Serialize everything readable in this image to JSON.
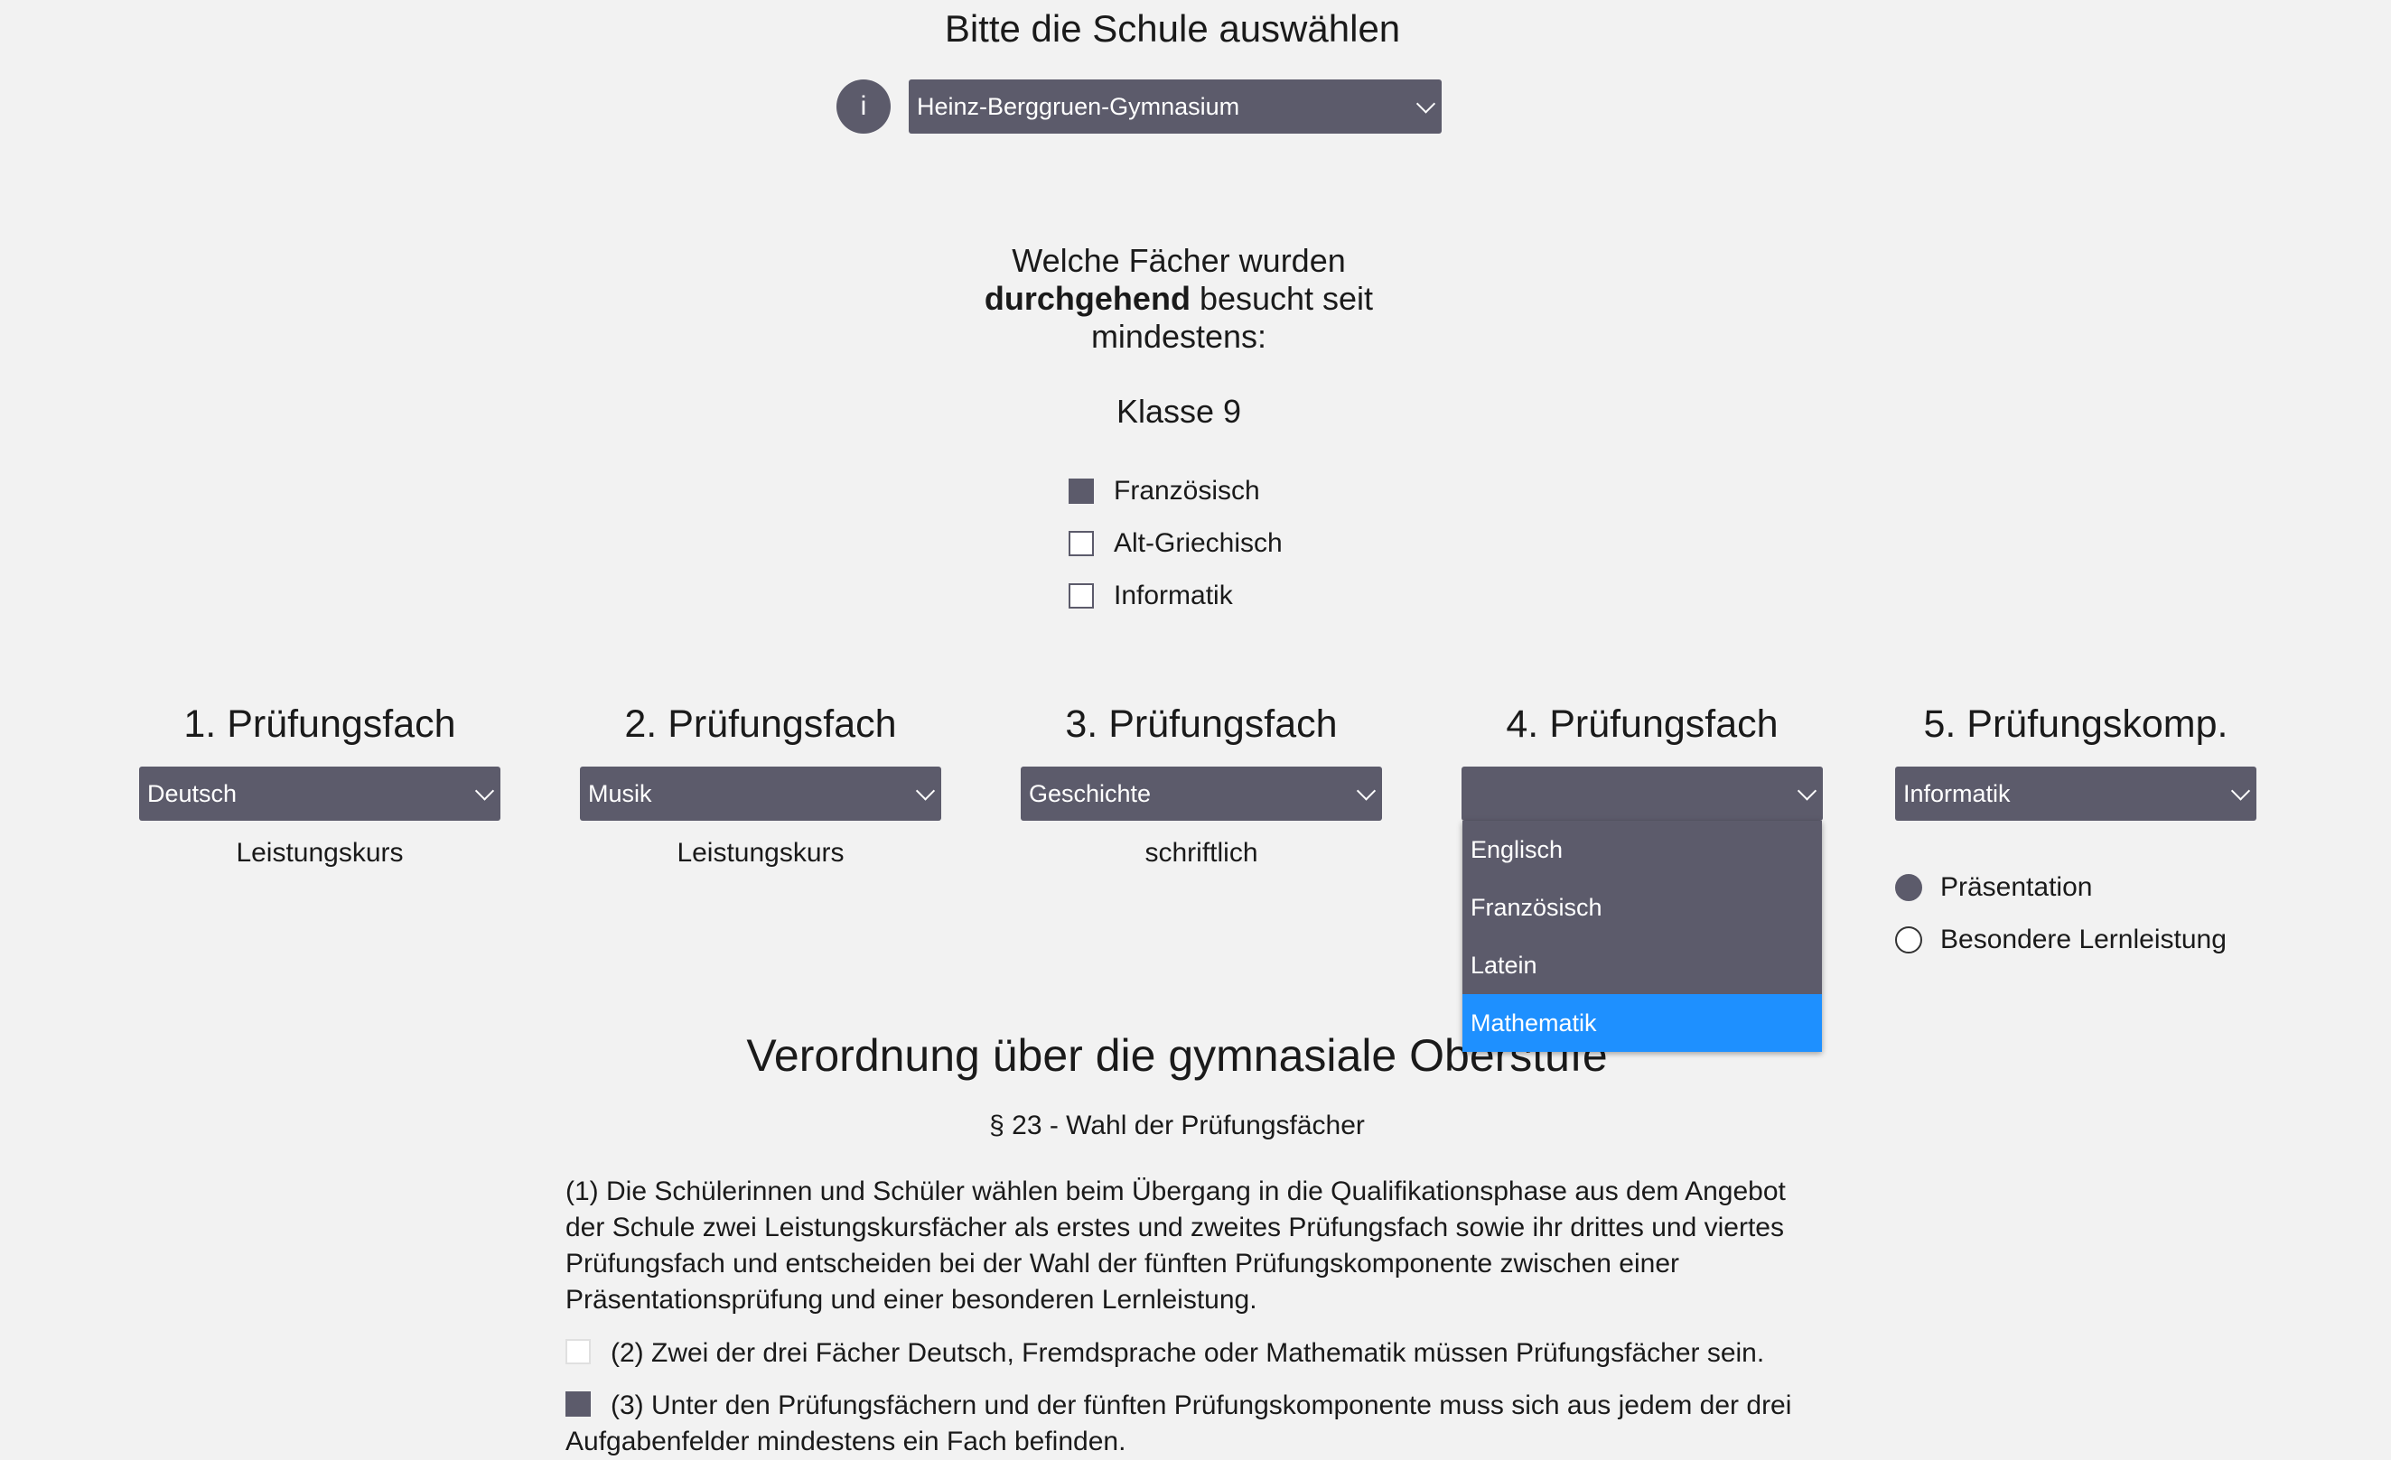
{
  "school": {
    "title": "Bitte die Schule auswählen",
    "info_label": "i",
    "selected": "Heinz-Berggruen-Gymnasium"
  },
  "question": {
    "line1": "Welche Fächer wurden",
    "bold": "durchgehend",
    "rest": " besucht seit",
    "line3": "mindestens:",
    "klasse": "Klasse 9"
  },
  "subjects": [
    {
      "label": "Französisch",
      "checked": true
    },
    {
      "label": "Alt-Griechisch",
      "checked": false
    },
    {
      "label": "Informatik",
      "checked": false
    }
  ],
  "exams": [
    {
      "heading": "1. Prüfungsfach",
      "selected": "Deutsch",
      "sub": "Leistungskurs"
    },
    {
      "heading": "2. Prüfungsfach",
      "selected": "Musik",
      "sub": "Leistungskurs"
    },
    {
      "heading": "3. Prüfungsfach",
      "selected": "Geschichte",
      "sub": "schriftlich"
    },
    {
      "heading": "4. Prüfungsfach",
      "selected": "",
      "sub": ""
    },
    {
      "heading": "5. Prüfungskomp.",
      "selected": "Informatik",
      "sub": ""
    }
  ],
  "dropdown_options": [
    "Englisch",
    "Französisch",
    "Latein",
    "Mathematik"
  ],
  "dropdown_highlighted": "Mathematik",
  "komponente": [
    {
      "label": "Präsentation",
      "selected": true
    },
    {
      "label": "Besondere Lernleistung",
      "selected": false
    }
  ],
  "law": {
    "title": "Verordnung über die gymnasiale Oberstufe",
    "section": "§ 23 - Wahl der Prüfungsfächer",
    "p1": "(1) Die Schülerinnen und Schüler wählen beim Übergang in die Qualifikationsphase aus dem Angebot der Schule zwei Leistungskursfächer als erstes und zweites Prüfungsfach sowie ihr drittes und viertes Prüfungsfach und entscheiden bei der Wahl der fünften Prüfungskomponente zwischen einer Präsentationsprüfung und einer besonderen Lernleistung.",
    "p2": "(2) Zwei der drei Fächer Deutsch, Fremdsprache oder Mathematik müssen Prüfungsfächer sein.",
    "p2_checked": false,
    "p3": "(3) Unter den Prüfungsfächern und der fünften Prüfungskomponente muss sich aus jedem der drei Aufgabenfelder mindestens ein Fach befinden.",
    "p3_checked": true
  },
  "colors": {
    "accent": "#5c5b6b",
    "highlight": "#1e90ff",
    "background": "#f2f2f2"
  }
}
